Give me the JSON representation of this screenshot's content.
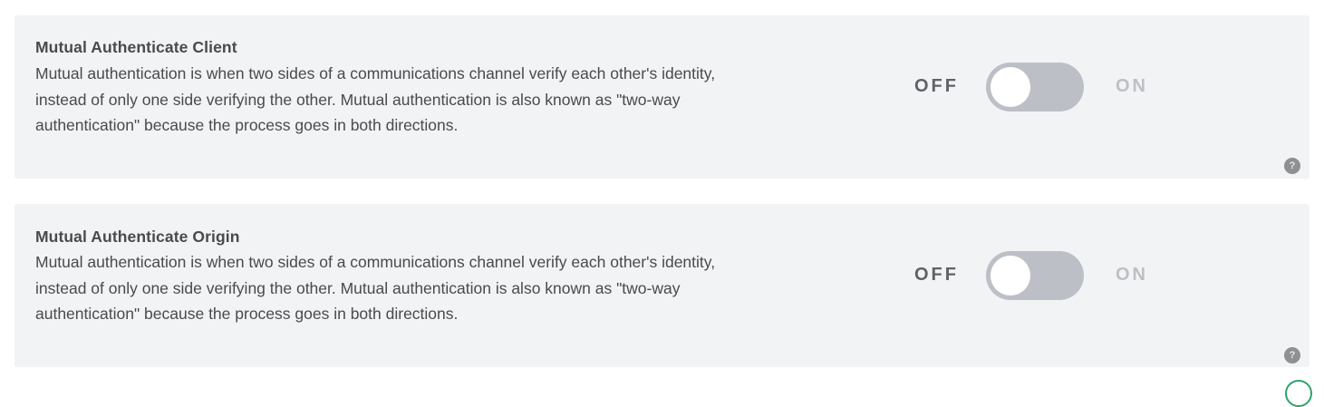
{
  "settings": [
    {
      "title": "Mutual Authenticate Client",
      "description": "Mutual authentication is when two sides of a communications channel verify each other's identity, instead of only one side verifying the other. Mutual authentication is also known as \"two-way authentication\" because the process goes in both directions.",
      "off_label": "OFF",
      "on_label": "ON",
      "state": "off",
      "help_glyph": "?"
    },
    {
      "title": "Mutual Authenticate Origin",
      "description": "Mutual authentication is when two sides of a communications channel verify each other's identity, instead of only one side verifying the other. Mutual authentication is also known as \"two-way authentication\" because the process goes in both directions.",
      "off_label": "OFF",
      "on_label": "ON",
      "state": "off",
      "help_glyph": "?"
    }
  ],
  "colors": {
    "card_background": "#f2f3f5",
    "text": "#4a4a4a",
    "toggle_track_off": "#bcc0c6",
    "help_icon": "#8e9093"
  }
}
